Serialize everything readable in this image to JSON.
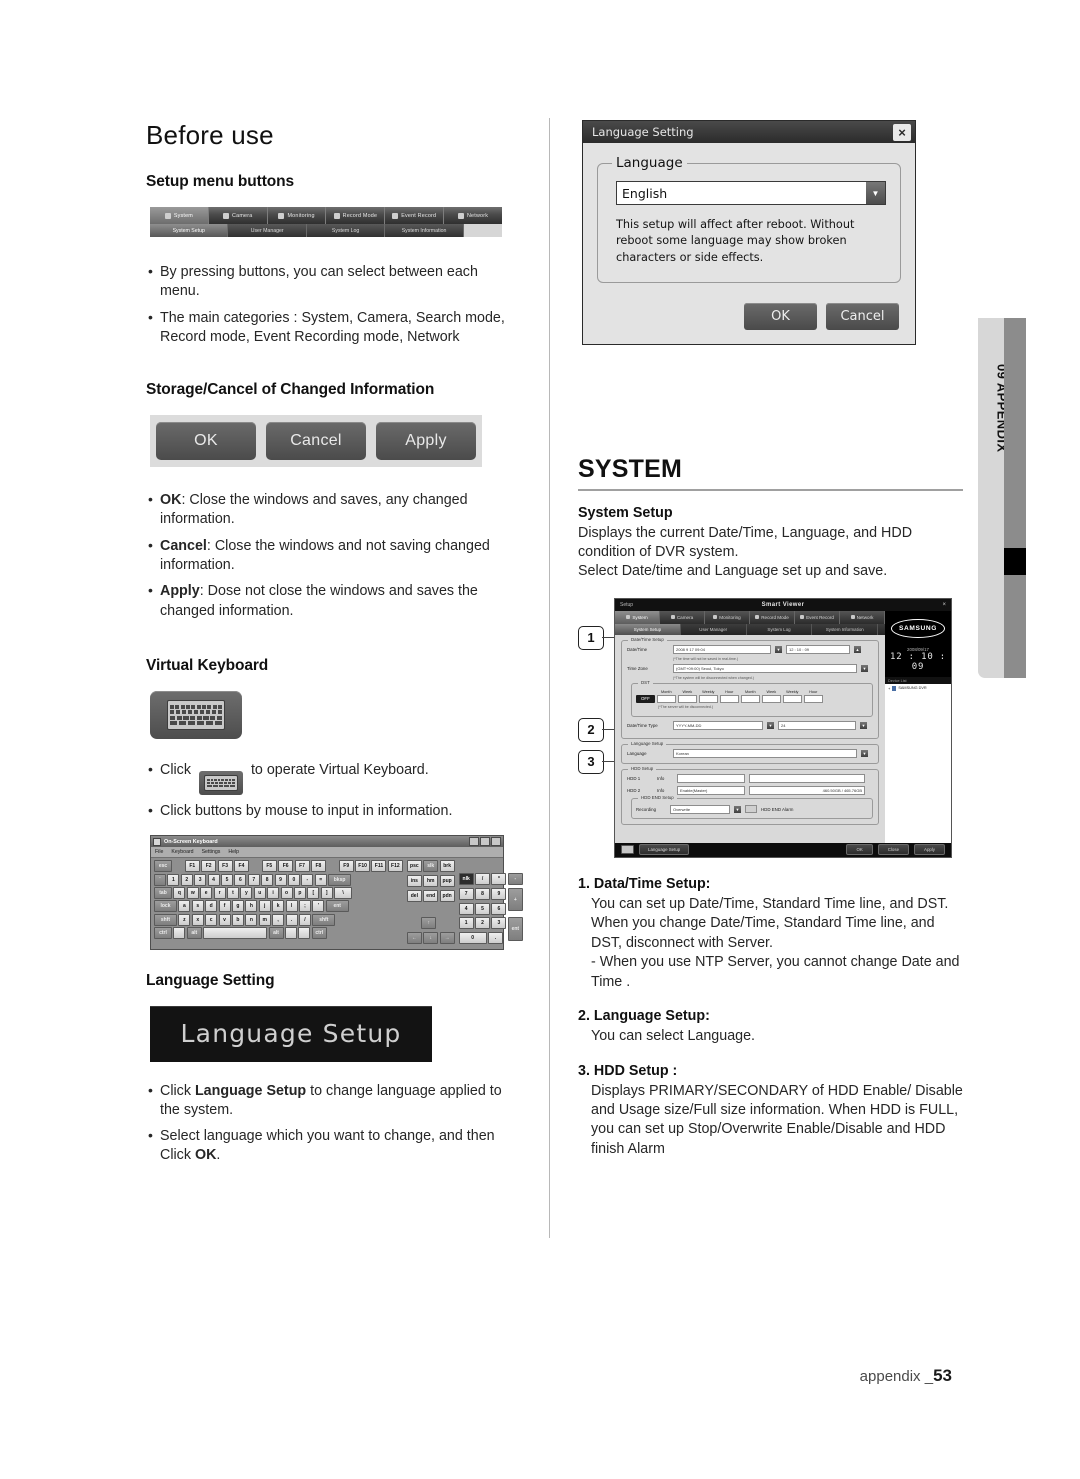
{
  "page": {
    "footer_label": "appendix _",
    "footer_number": "53",
    "side_tab": "09 APPENDIX"
  },
  "left": {
    "title": "Before use",
    "setup_menu": {
      "heading": "Setup menu buttons",
      "menubar": {
        "tabs": [
          {
            "label": "System",
            "icon": "system-icon",
            "selected": true
          },
          {
            "label": "Camera",
            "icon": "camera-icon",
            "selected": false
          },
          {
            "label": "Monitoring",
            "icon": "monitor-icon",
            "selected": false
          },
          {
            "label": "Record Mode",
            "icon": "record-icon",
            "selected": false
          },
          {
            "label": "Event Record",
            "icon": "event-icon",
            "selected": false
          },
          {
            "label": "Network",
            "icon": "network-icon",
            "selected": false
          }
        ],
        "subtabs": [
          {
            "label": "System Setup",
            "selected": true
          },
          {
            "label": "User Manager",
            "selected": false
          },
          {
            "label": "System Log",
            "selected": false
          },
          {
            "label": "System Information",
            "selected": false
          }
        ]
      },
      "bullets": [
        "By pressing buttons, you can select between each menu.",
        "The main categories : System, Camera, Search mode, Record mode, Event Recording mode, Network"
      ]
    },
    "storage": {
      "heading": "Storage/Cancel of Changed Information",
      "buttons": [
        "OK",
        "Cancel",
        "Apply"
      ],
      "bullets": [
        {
          "term": "OK",
          "sep": ":",
          "text": "  Close the windows and saves, any changed information."
        },
        {
          "term": "Cancel",
          "sep": ":",
          "text": " Close the windows and not saving changed information."
        },
        {
          "term": "Apply",
          "sep": ":",
          "text": " Dose not close the windows and saves the changed information."
        }
      ]
    },
    "virtual_keyboard": {
      "heading": "Virtual Keyboard",
      "bullet1_prefix": "Click",
      "bullet1_suffix": "to operate Virtual Keyboard.",
      "bullet2": "Click buttons by mouse to input in information.",
      "osk": {
        "window_title": "On-Screen Keyboard",
        "menu": [
          "File",
          "Keyboard",
          "Settings",
          "Help"
        ],
        "rows": {
          "fn": [
            "esc",
            "F1",
            "F2",
            "F3",
            "F4",
            "F5",
            "F6",
            "F7",
            "F8",
            "F9",
            "F10",
            "F11",
            "F12",
            "psc",
            "slk",
            "brk"
          ],
          "num": [
            "`",
            "1",
            "2",
            "3",
            "4",
            "5",
            "6",
            "7",
            "8",
            "9",
            "0",
            "-",
            "=",
            "bksp"
          ],
          "top": [
            "tab",
            "q",
            "w",
            "e",
            "r",
            "t",
            "y",
            "u",
            "i",
            "o",
            "p",
            "[",
            "]",
            "\\"
          ],
          "home": [
            "lock",
            "a",
            "s",
            "d",
            "f",
            "g",
            "h",
            "j",
            "k",
            "l",
            ";",
            "'",
            "ent"
          ],
          "bottom": [
            "shft",
            "z",
            "x",
            "c",
            "v",
            "b",
            "n",
            "m",
            ",",
            ".",
            "/",
            "shft"
          ],
          "space": [
            "ctrl",
            "win",
            "alt",
            " ",
            "alt",
            "win",
            "menu",
            "ctrl"
          ],
          "nav_upper": [
            "ins",
            "hm",
            "pup"
          ],
          "nav_lower": [
            "del",
            "end",
            "pdn"
          ],
          "arrows": [
            "↑",
            "←",
            "↓",
            "→"
          ],
          "pad": [
            "nlk",
            "/",
            "*",
            "-",
            "7",
            "8",
            "9",
            "4",
            "5",
            "6",
            "+",
            "1",
            "2",
            "3",
            "0",
            ".",
            "ent"
          ]
        }
      }
    },
    "language_setting": {
      "heading": "Language Setting",
      "banner_label": "Language Setup",
      "bullets": [
        {
          "pre": "Click ",
          "bold": "Language Setup",
          "post": " to change language applied to the system."
        },
        {
          "pre": "Select language which you want to change, and then Click ",
          "bold": "OK",
          "post": "."
        }
      ]
    }
  },
  "right": {
    "language_dialog": {
      "title": "Language Setting",
      "close_icon": "×",
      "group_label": "Language",
      "selected_language": "English",
      "note": "This setup will affect after reboot. Without reboot some language may show broken characters or side effects.",
      "ok_label": "OK",
      "cancel_label": "Cancel"
    },
    "system": {
      "heading": "SYSTEM",
      "setup_heading": "System Setup",
      "setup_body": "Displays the current Date/Time, Language, and HDD condition of DVR system.\nSelect Date/time and Language set up and save.",
      "items": [
        {
          "num": "1.",
          "title": "Data/Time Setup:",
          "body": "You can set up Date/Time, Standard Time line, and DST. When you change Date/Time, Standard Time line, and DST, disconnect with Server.",
          "sub": "- When you use NTP Server, you cannot change Date and Time ."
        },
        {
          "num": "2.",
          "title": "Language Setup:",
          "body": "You can select Language.",
          "sub": ""
        },
        {
          "num": "3.",
          "title": "HDD Setup :",
          "body": "Displays PRIMARY/SECONDARY of HDD Enable/ Disable and Usage size/Full size information. When HDD is FULL, you can set up Stop/Overwrite Enable/Disable and HDD finish Alarm",
          "sub": ""
        }
      ]
    },
    "smart_viewer": {
      "window_label": "Setup",
      "window_title": "Smart Viewer",
      "close_icon": "×",
      "tabs": [
        {
          "label": "System",
          "selected": true
        },
        {
          "label": "Camera",
          "selected": false
        },
        {
          "label": "Monitoring",
          "selected": false
        },
        {
          "label": "Record Mode",
          "selected": false
        },
        {
          "label": "Event Record",
          "selected": false
        },
        {
          "label": "Network",
          "selected": false
        }
      ],
      "subtabs": [
        {
          "label": "System Setup",
          "selected": true
        },
        {
          "label": "User Manager",
          "selected": false
        },
        {
          "label": "System Log",
          "selected": false
        },
        {
          "label": "System Information",
          "selected": false
        }
      ],
      "callouts": [
        "1",
        "2",
        "3"
      ],
      "groups": {
        "datetime": {
          "legend": "Date/Time Setup",
          "date_label": "Date/Time",
          "date_value": "2008    9    17  09:04",
          "time_value": "12 : 10 : 09",
          "hint1": "(*The time will not be saved in real-time.)",
          "timezone_label": "Time Zone",
          "timezone_value": "(GMT+09:00) Seoul, Tokyo",
          "hint2": "(*The system will be disconnected when changed.)",
          "dst_legend": "DST",
          "dst_state": "OFF",
          "dst_cols": [
            "Month",
            "Week",
            "Weekly",
            "Hour",
            "Month",
            "Week",
            "Weekly",
            "Hour"
          ],
          "dst_hint": "(*The server will be disconnected.)",
          "type_label": "Date/Time Type",
          "type_value": "YYYY-MM-DD",
          "type_value2": "24"
        },
        "language": {
          "legend": "Language Setup",
          "label": "Language",
          "value": "Korean"
        },
        "hdd": {
          "legend": "HDD Setup",
          "row1_label": "HDD 1",
          "row1_info": "Info",
          "row2_label": "HDD 2",
          "row2_info": "Info",
          "row2_value": "Enable(Master)",
          "row2_value2": "460.50GB / 465.76GB",
          "sub_legend": "HDD END Setup",
          "sub_label": "Recording",
          "sub_value": "Overwrite",
          "sub_check": "HDD END Alarm"
        }
      },
      "sidebar": {
        "brand": "SAMSUNG",
        "date": "2008/09/17",
        "clock": "12 : 10 : 09",
        "device_header": "Device List",
        "device_name": "SAMSUNG DVR"
      },
      "footer": {
        "keyboard_icon": "keyboard-icon",
        "language_setup": "Language Setup",
        "ok": "OK",
        "close": "Close",
        "apply": "Apply"
      }
    }
  }
}
